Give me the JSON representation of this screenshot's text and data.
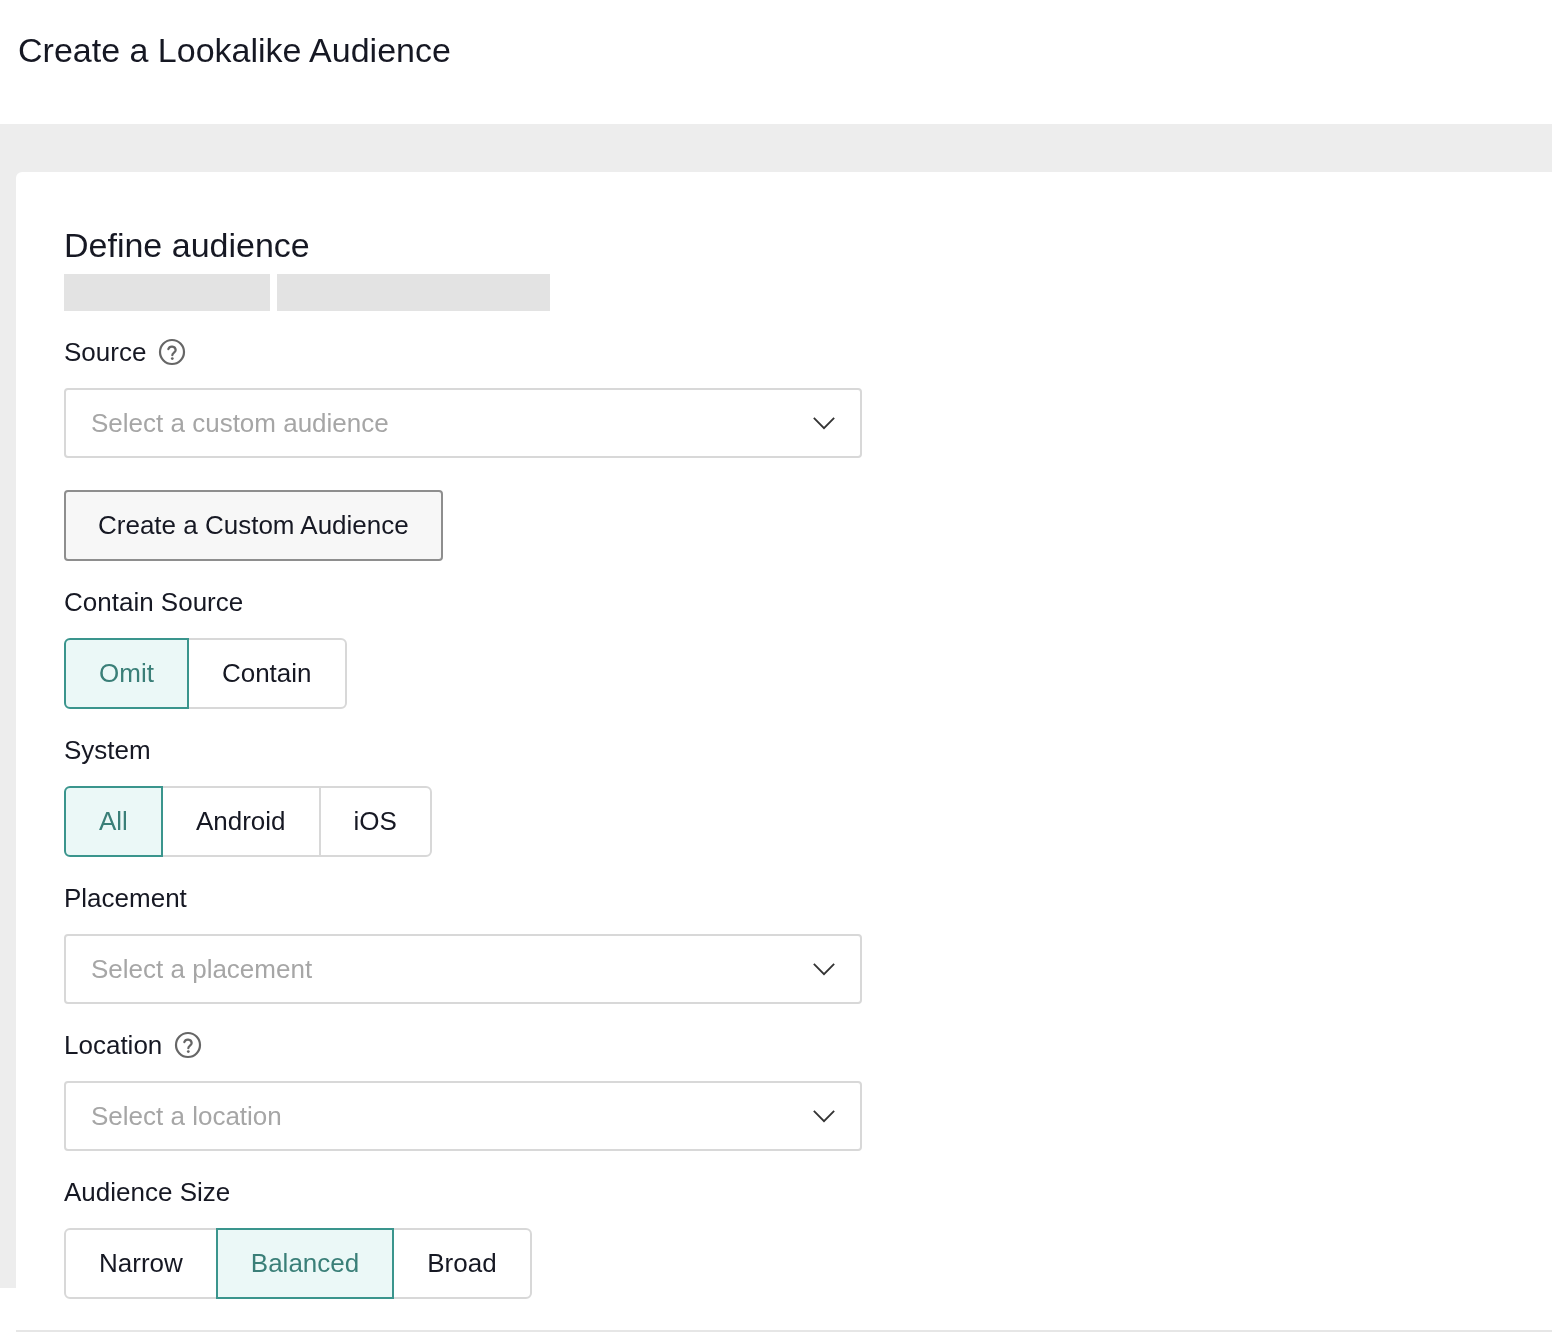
{
  "page_title": "Create a Lookalike Audience",
  "card": {
    "title": "Define audience",
    "fields": [
      {
        "kind": "select",
        "label": "Source",
        "help": true,
        "placeholder": "Select a custom audience"
      },
      {
        "kind": "button",
        "text": "Create a Custom Audience"
      },
      {
        "kind": "segmented",
        "label": "Contain Source",
        "options": [
          {
            "label": "Omit",
            "selected": true
          },
          {
            "label": "Contain",
            "selected": false
          }
        ]
      },
      {
        "kind": "segmented",
        "label": "System",
        "options": [
          {
            "label": "All",
            "selected": true
          },
          {
            "label": "Android",
            "selected": false
          },
          {
            "label": "iOS",
            "selected": false
          }
        ]
      },
      {
        "kind": "select",
        "label": "Placement",
        "help": false,
        "placeholder": "Select a placement"
      },
      {
        "kind": "select",
        "label": "Location",
        "help": true,
        "placeholder": "Select a location"
      },
      {
        "kind": "segmented",
        "label": "Audience Size",
        "options": [
          {
            "label": "Narrow",
            "selected": false
          },
          {
            "label": "Balanced",
            "selected": true
          },
          {
            "label": "Broad",
            "selected": false
          }
        ]
      }
    ]
  }
}
